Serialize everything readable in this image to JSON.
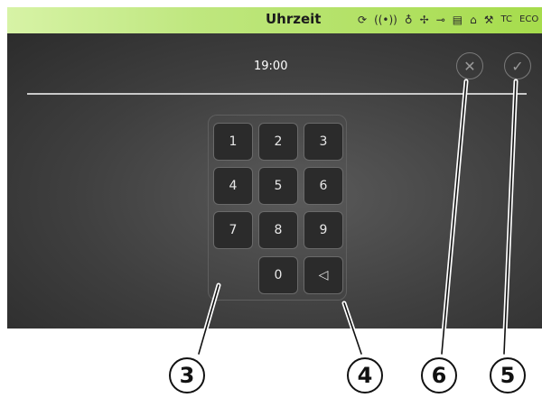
{
  "header": {
    "title": "Uhrzeit",
    "status_tc": "TC",
    "status_eco": "ECO"
  },
  "time_value": "19:00",
  "buttons": {
    "cancel_icon": "x-icon",
    "confirm_icon": "check-icon"
  },
  "keypad": {
    "keys": [
      "1",
      "2",
      "3",
      "4",
      "5",
      "6",
      "7",
      "8",
      "9",
      "0"
    ],
    "backspace_icon": "backspace-triangle-icon"
  },
  "callouts": [
    "3",
    "4",
    "6",
    "5"
  ],
  "colors": {
    "header_green": "#a6dc4c",
    "screen_bg": "#3f3f3f"
  }
}
